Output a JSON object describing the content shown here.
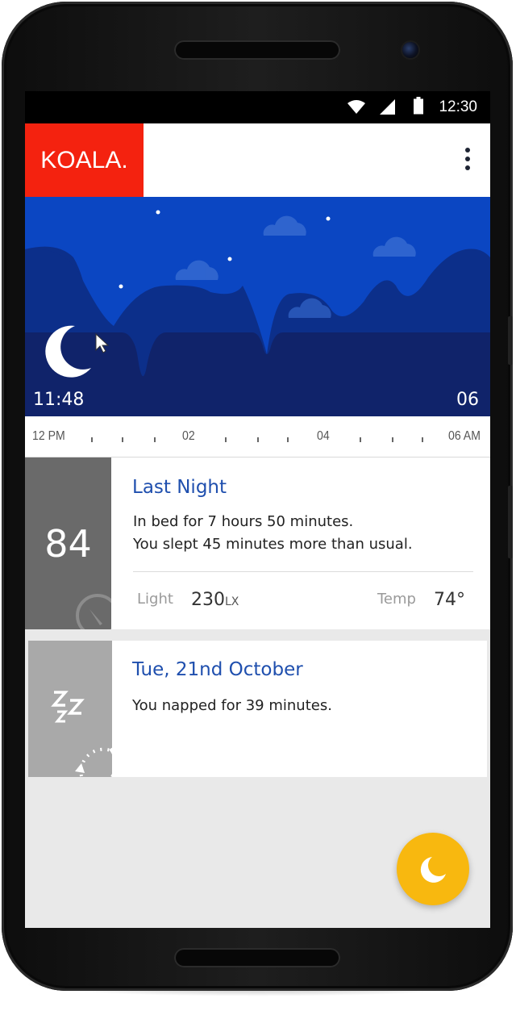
{
  "status_bar": {
    "time": "12:30"
  },
  "app_bar": {
    "logo": "KOALA."
  },
  "hero": {
    "start_time": "11:48",
    "end_time": "06"
  },
  "timeline": {
    "labels": [
      "12 PM",
      "02",
      "04",
      "06 AM"
    ]
  },
  "cards": [
    {
      "score": "84",
      "title": "Last Night",
      "lines": [
        "In bed for 7 hours 50 minutes.",
        "You slept 45 minutes more than usual."
      ],
      "light_label": "Light",
      "light_value": "230",
      "light_unit": "LX",
      "temp_label": "Temp",
      "temp_value": "74°"
    },
    {
      "title": "Tue, 21nd October",
      "text": "You napped for 39 minutes."
    }
  ],
  "colors": {
    "brand": "#f4220f",
    "sky": "#0b46c2",
    "mountain": "#0c2f8a",
    "ground": "#10236a",
    "title_blue": "#1f4fae",
    "fab": "#f8b80f"
  },
  "icons": [
    "wifi-icon",
    "signal-icon",
    "battery-icon",
    "more-vert-icon",
    "moon-icon",
    "gauge-icon",
    "zzz-icon",
    "nap-timer-icon"
  ]
}
